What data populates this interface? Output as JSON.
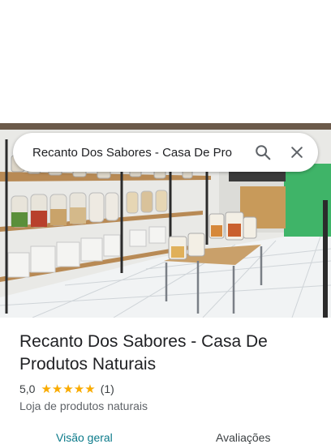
{
  "search": {
    "query": "Recanto Dos Sabores - Casa De Pro"
  },
  "place": {
    "name": "Recanto Dos Sabores - Casa De Produtos Naturais",
    "rating": "5,0",
    "stars": "★★★★★",
    "review_count": "(1)",
    "category": "Loja de produtos naturais"
  },
  "tabs": [
    {
      "label": "Visão geral",
      "active": true
    },
    {
      "label": "Avaliações",
      "active": false
    }
  ],
  "colors": {
    "accent": "#0b7a8a",
    "star": "#f9ab00",
    "wall_green": "#3fb468"
  },
  "icons": [
    "search-icon",
    "close-icon"
  ]
}
